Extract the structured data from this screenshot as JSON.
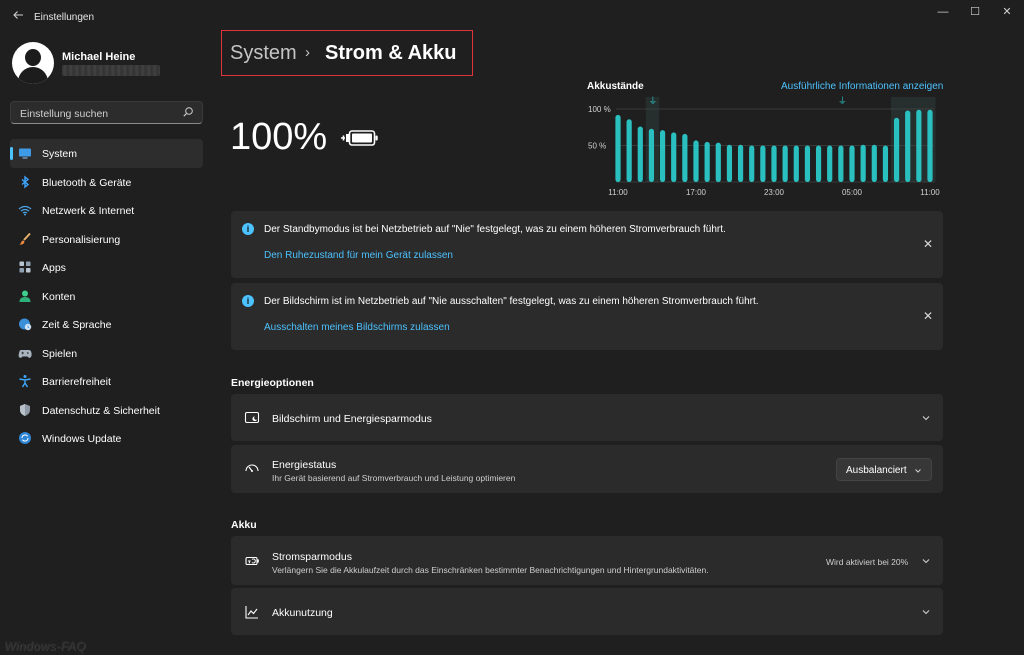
{
  "window": {
    "title": "Einstellungen",
    "minimize_glyph": "—",
    "maximize_glyph": "☐",
    "close_glyph": "✕"
  },
  "profile": {
    "name": "Michael Heine"
  },
  "search": {
    "placeholder": "Einstellung suchen"
  },
  "sidebar": {
    "items": [
      {
        "label": "System",
        "icon": "monitor-icon",
        "active": true
      },
      {
        "label": "Bluetooth & Geräte",
        "icon": "bluetooth-icon"
      },
      {
        "label": "Netzwerk & Internet",
        "icon": "wifi-icon"
      },
      {
        "label": "Personalisierung",
        "icon": "brush-icon"
      },
      {
        "label": "Apps",
        "icon": "apps-icon"
      },
      {
        "label": "Konten",
        "icon": "person-icon"
      },
      {
        "label": "Zeit & Sprache",
        "icon": "globe-clock-icon"
      },
      {
        "label": "Spielen",
        "icon": "gamepad-icon"
      },
      {
        "label": "Barrierefreiheit",
        "icon": "accessibility-icon"
      },
      {
        "label": "Datenschutz & Sicherheit",
        "icon": "shield-icon"
      },
      {
        "label": "Windows Update",
        "icon": "update-icon"
      }
    ]
  },
  "header": {
    "breadcrumb_parent": "System",
    "breadcrumb_sep": "›",
    "breadcrumb_current": "Strom & Akku"
  },
  "battery": {
    "percent_text": "100%",
    "percent": 100,
    "charging": true
  },
  "battery_chart": {
    "title": "Akkustände",
    "details_link": "Ausführliche Informationen anzeigen"
  },
  "chart_data": {
    "type": "bar",
    "title": "Akkustände",
    "ytick_labels": [
      "100 %",
      "50 %"
    ],
    "ylim": [
      0,
      100
    ],
    "xtick_labels": [
      "11:00",
      "17:00",
      "23:00",
      "05:00",
      "11:00"
    ],
    "values": [
      92,
      86,
      76,
      73,
      71,
      68,
      66,
      57,
      55,
      54,
      51,
      51,
      50,
      50,
      50,
      50,
      50,
      50,
      50,
      50,
      50,
      50,
      51,
      51,
      50,
      88,
      98,
      99,
      99
    ],
    "charging_markers_at_index": [
      3,
      20
    ],
    "bar_color": "#2ac0c0",
    "grid": true
  },
  "notices": [
    {
      "text": "Der Standbymodus ist bei Netzbetrieb auf \"Nie\" festgelegt, was zu einem höheren Stromverbrauch führt.",
      "link": "Den Ruhezustand für mein Gerät zulassen"
    },
    {
      "text": "Der Bildschirm ist im Netzbetrieb auf \"Nie ausschalten\" festgelegt, was zu einem höheren Stromverbrauch führt.",
      "link": "Ausschalten meines Bildschirms zulassen"
    }
  ],
  "energy_section": {
    "heading": "Energieoptionen",
    "screen_sleep": {
      "title": "Bildschirm und Energiesparmodus"
    },
    "power_mode": {
      "title": "Energiestatus",
      "subtitle": "Ihr Gerät basierend auf Stromverbrauch und Leistung optimieren",
      "selected": "Ausbalanciert"
    }
  },
  "battery_section": {
    "heading": "Akku",
    "saver": {
      "title": "Stromsparmodus",
      "subtitle": "Verlängern Sie die Akkulaufzeit durch das Einschränken bestimmter Benachrichtigungen und Hintergrundaktivitäten.",
      "status": "Wird aktiviert bei 20%"
    },
    "usage": {
      "title": "Akkunutzung"
    }
  },
  "watermark": "Windows-FAQ",
  "colors": {
    "accent": "#4cc2ff",
    "highlight_box": "#e0323a",
    "bar": "#2ac0c0",
    "card": "#2b2b2b"
  }
}
